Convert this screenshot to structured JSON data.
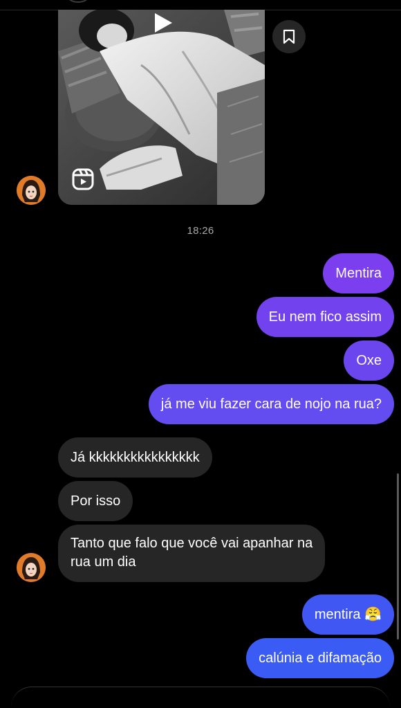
{
  "media_post": {
    "type": "reel",
    "save_icon": "bookmark-icon",
    "reel_icon": "reels-icon",
    "play_icon": "play-icon"
  },
  "timestamp": "18:26",
  "messages": {
    "out_1": "Mentira",
    "out_2": "Eu nem fico assim",
    "out_3": "Oxe",
    "out_4": "já me viu fazer cara de nojo na rua?",
    "in_1": "Já kkkkkkkkkkkkkkkk",
    "in_2": "Por isso",
    "in_3_line1": "Tanto que falo que você vai apanhar na",
    "in_3_line2": "rua um dia",
    "out_5": "mentira 😤",
    "out_6": "calúnia e difamação"
  },
  "colors": {
    "background": "#000000",
    "incoming_bubble": "#262626",
    "outgoing_purple": "#7c3aed",
    "outgoing_blue": "#3b5bf5",
    "timestamp_text": "#a8a8a8"
  }
}
